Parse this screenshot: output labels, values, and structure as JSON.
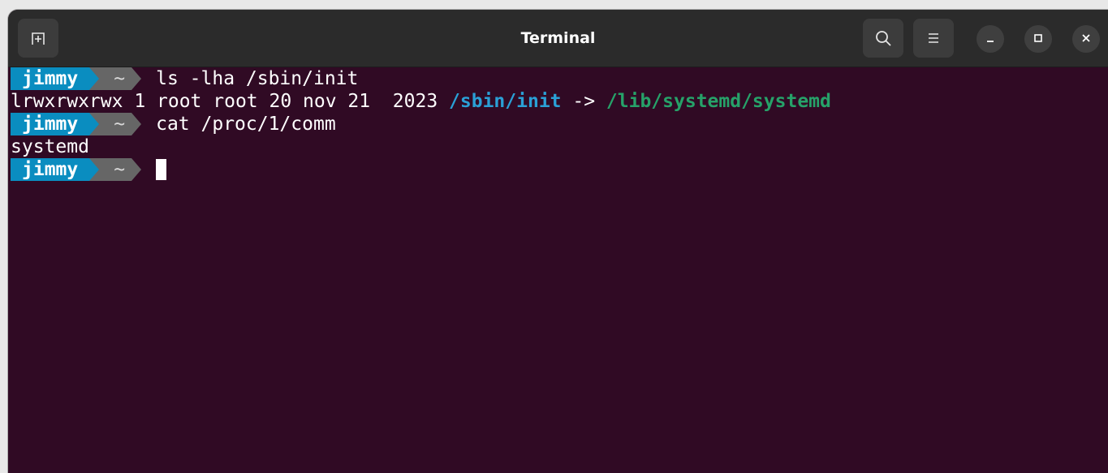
{
  "window": {
    "title": "Terminal"
  },
  "titlebar": {
    "new_tab_icon": "new-tab-icon",
    "search_icon": "search-icon",
    "menu_icon": "hamburger-menu-icon",
    "minimize_icon": "minimize-icon",
    "maximize_icon": "maximize-icon",
    "close_icon": "close-icon"
  },
  "prompt": {
    "user": "jimmy",
    "dir": "~"
  },
  "terminal": {
    "lines": [
      {
        "type": "prompt",
        "command": "ls -lha /sbin/init"
      },
      {
        "type": "output",
        "prefix": "lrwxrwxrwx 1 root root 20 nov 21  2023 ",
        "link_src": "/sbin/init",
        "arrow": " -> ",
        "link_dst": "/lib/systemd/systemd"
      },
      {
        "type": "prompt",
        "command": "cat /proc/1/comm"
      },
      {
        "type": "output",
        "text": "systemd"
      },
      {
        "type": "prompt",
        "command": ""
      }
    ]
  },
  "colors": {
    "background": "#300a24",
    "user_segment": "#0a8dc0",
    "dir_segment": "#666666",
    "link_src": "#2aa0d6",
    "link_dst": "#26a269"
  }
}
